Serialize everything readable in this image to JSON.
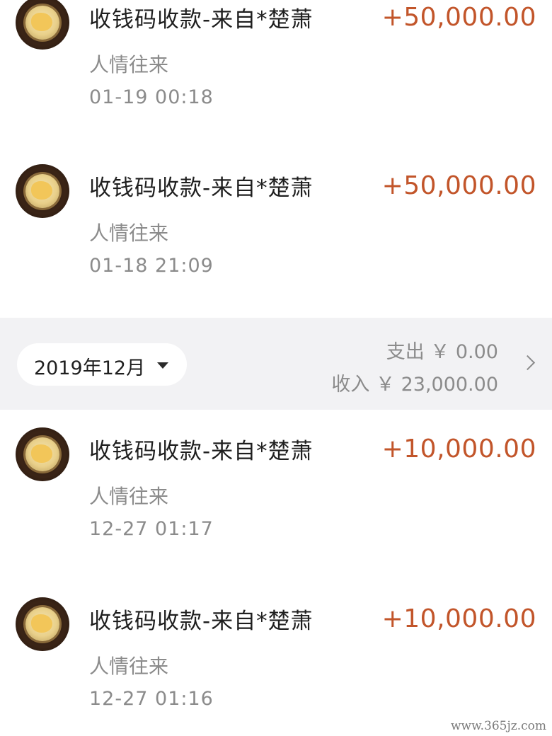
{
  "transactions_top": [
    {
      "title": "收钱码收款-来自*楚萧",
      "amount": "+50,000.00",
      "category": "人情往来",
      "time": "01-19  00:18"
    },
    {
      "title": "收钱码收款-来自*楚萧",
      "amount": "+50,000.00",
      "category": "人情往来",
      "time": "01-18  21:09"
    }
  ],
  "month_summary": {
    "month": "2019年12月",
    "expense": "支出 ￥ 0.00",
    "income": "收入 ￥ 23,000.00"
  },
  "transactions_bottom": [
    {
      "title": "收钱码收款-来自*楚萧",
      "amount": "+10,000.00",
      "category": "人情往来",
      "time": "12-27  01:17"
    },
    {
      "title": "收钱码收款-来自*楚萧",
      "amount": "+10,000.00",
      "category": "人情往来",
      "time": "12-27  01:16"
    }
  ],
  "watermark": "www.365jz.com",
  "colors": {
    "amount": "#c2552a",
    "secondary_text": "#8b8b8b",
    "month_bar_bg": "#f2f2f4"
  }
}
